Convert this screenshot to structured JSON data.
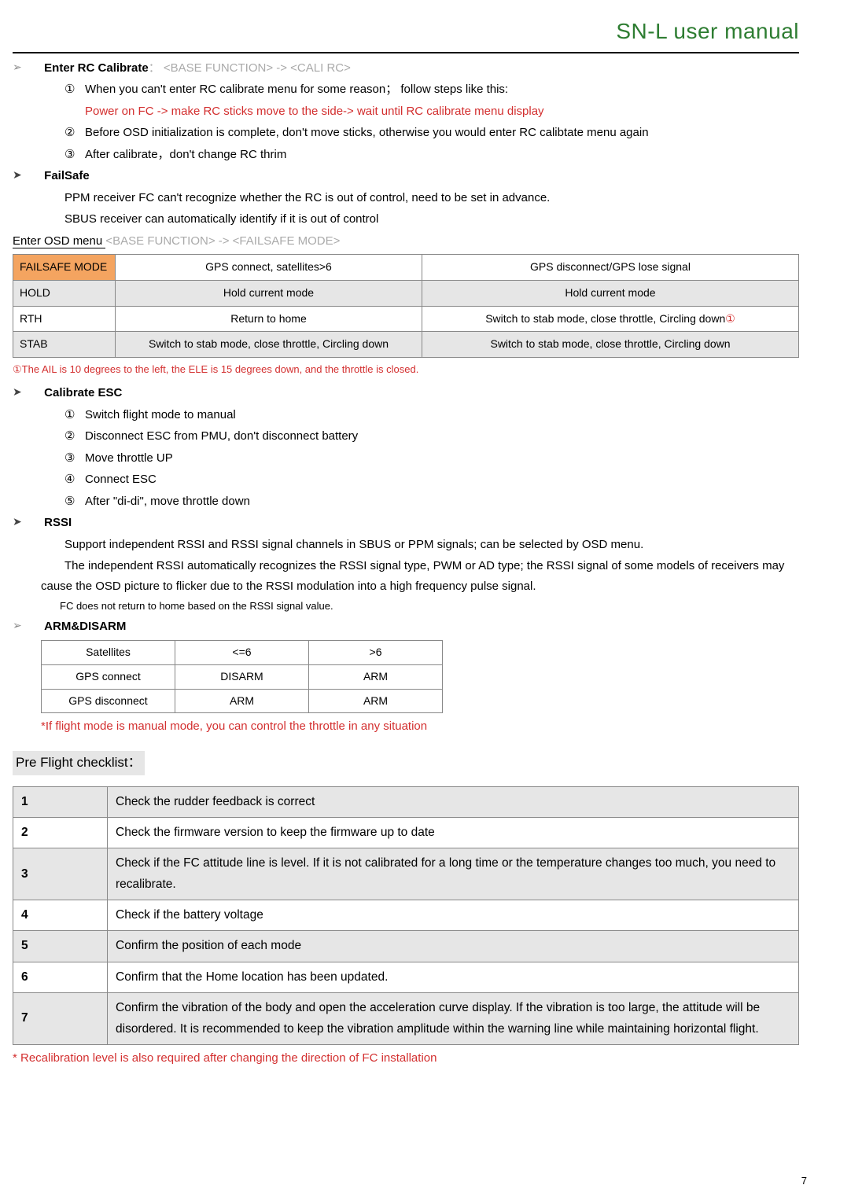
{
  "header": {
    "title": "SN-L user manual"
  },
  "sec_rc": {
    "heading_prefix": "Enter RC Calibrate",
    "heading_path": "：  <BASE FUNCTION> -> <CALI RC>",
    "items": {
      "n1": "①",
      "t1a": "When you can't enter RC calibrate menu for some reason；   follow steps like this:",
      "t1b": "Power on FC -> make RC sticks move to the side-> wait until RC calibrate menu display",
      "n2": "②",
      "t2": "Before OSD initialization is complete, don't move sticks, otherwise you would enter RC calibtate menu again",
      "n3": "③",
      "t3": "After calibrate，don't change RC thrim"
    }
  },
  "sec_fs": {
    "heading": "FailSafe",
    "p1": "PPM receiver FC can't recognize whether the RC is out of control, need to be set in advance.",
    "p2": "SBUS receiver can automatically identify if it is out of control",
    "enter_label": "Enter OSD menu ",
    "enter_path": "<BASE FUNCTION> -> <FAILSAFE MODE>",
    "table": {
      "h0": "FAILSAFE MODE",
      "h1": "GPS connect,    satellites>6",
      "h2": "GPS disconnect/GPS lose signal",
      "r1c0": "HOLD",
      "r1c1": "Hold current mode",
      "r1c2": "Hold current mode",
      "r2c0": "RTH",
      "r2c1": "Return to home",
      "r2c2a": "Switch to stab mode, close throttle, Circling down",
      "r2c2b": "①",
      "r3c0": "STAB",
      "r3c1": "Switch to stab mode, close throttle, Circling down",
      "r3c2": "Switch to stab mode, close throttle, Circling down"
    },
    "note": "①The AIL is 10 degrees to the left, the ELE is 15 degrees down, and the throttle is closed."
  },
  "sec_esc": {
    "heading": "Calibrate ESC",
    "n1": "①",
    "t1": "Switch flight mode to manual",
    "n2": "②",
    "t2": "Disconnect ESC from PMU, don't disconnect battery",
    "n3": "③",
    "t3": "Move throttle UP",
    "n4": "④",
    "t4": "Connect ESC",
    "n5": "⑤",
    "t5": "After \"di-di\", move throttle down"
  },
  "sec_rssi": {
    "heading": "RSSI",
    "p1": "Support independent RSSI and RSSI signal channels in SBUS or PPM signals; can be selected by OSD menu.",
    "p2": "The independent RSSI automatically recognizes the RSSI signal type, PWM or AD type; the RSSI signal of some models of receivers may cause the OSD picture to flicker due to the RSSI modulation into a high frequency pulse signal.",
    "p3": "FC does not return to home based on the RSSI signal value."
  },
  "sec_arm": {
    "heading": "ARM&DISARM",
    "table": {
      "h0": "Satellites",
      "h1": "<=6",
      "h2": ">6",
      "r1c0": "GPS connect",
      "r1c1": "DISARM",
      "r1c2": "ARM",
      "r2c0": "GPS disconnect",
      "r2c1": "ARM",
      "r2c2": "ARM"
    },
    "note": "*If flight mode is manual mode, you can control the throttle in any situation"
  },
  "sec_pre": {
    "heading": "Pre Flight checklist：",
    "rows": {
      "n1": "1",
      "t1": "Check the rudder feedback is correct",
      "n2": "2",
      "t2": "Check the firmware version to keep the firmware up to date",
      "n3": "3",
      "t3": "Check if the FC attitude line is level. If it is not calibrated for a long time or the temperature changes too much, you need to recalibrate.",
      "n4": "4",
      "t4": "Check if the battery voltage",
      "n5": "5",
      "t5": "Confirm the position of each mode",
      "n6": "6",
      "t6": "Confirm that the Home location has been updated.",
      "n7": "7",
      "t7": "Confirm the vibration of the body and open the acceleration curve display. If the vibration is too large, the attitude will be disordered. It is recommended to keep the vibration amplitude within the warning line while maintaining horizontal flight."
    },
    "footnote": "* Recalibration level is also required after changing the direction of FC installation"
  },
  "page_number": "7"
}
